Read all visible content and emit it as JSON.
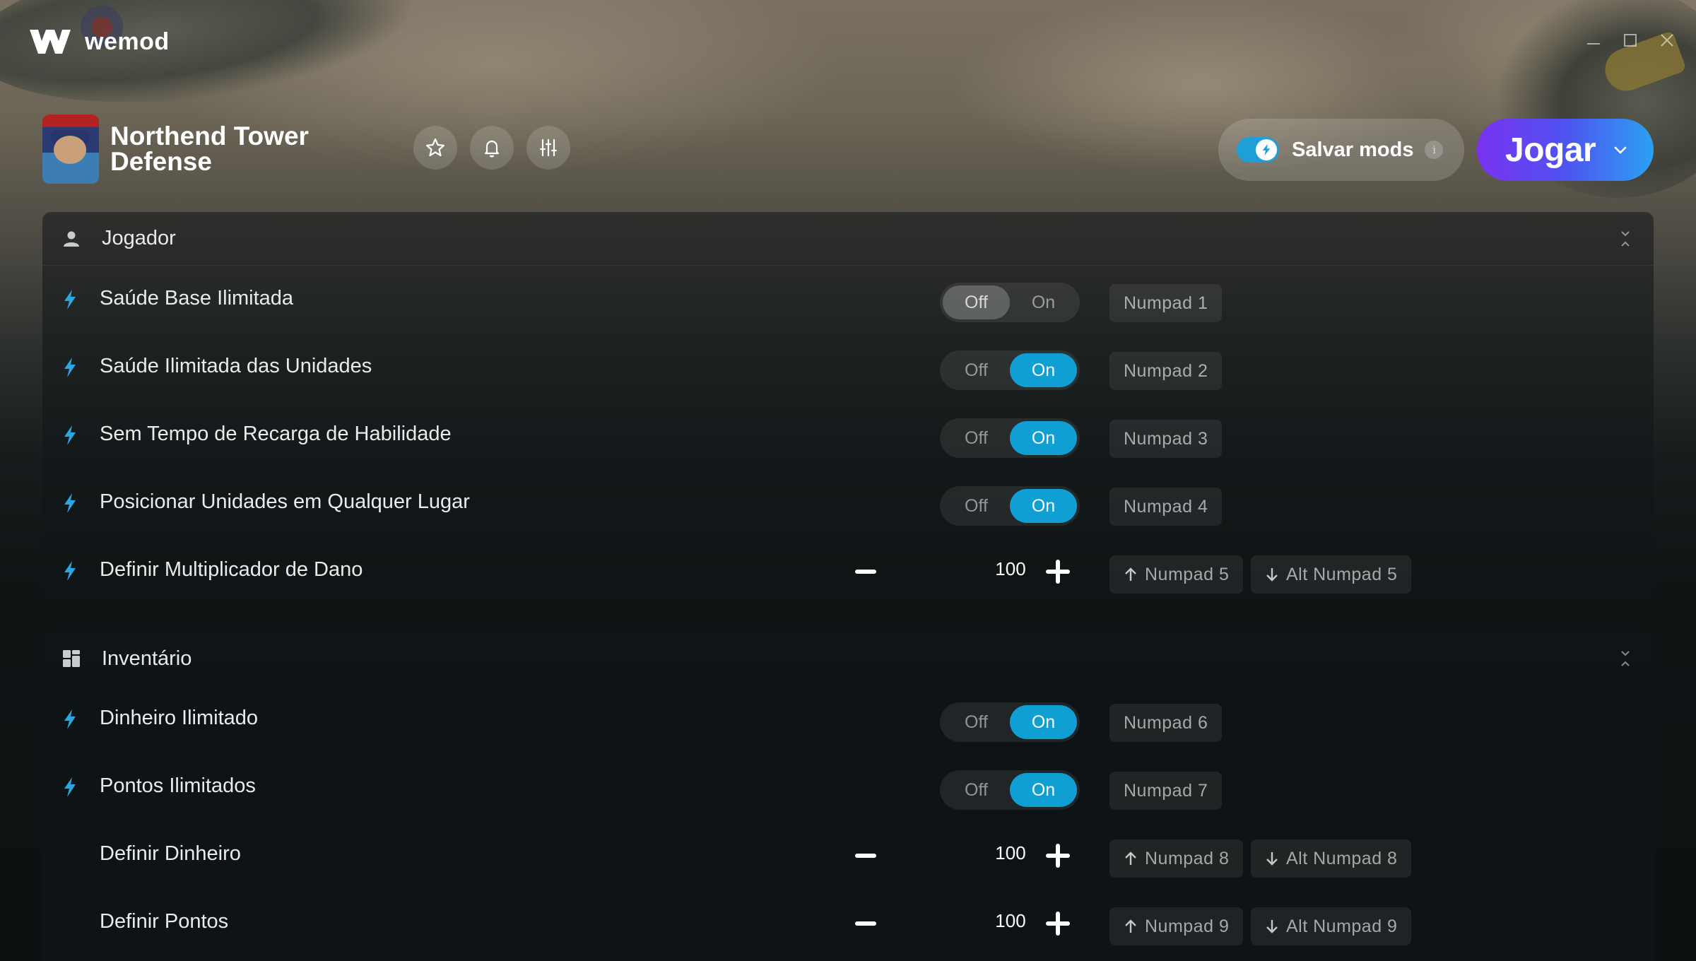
{
  "app": {
    "name": "wemod"
  },
  "game": {
    "title": "Northend Tower Defense"
  },
  "header": {
    "save_mods_label": "Salvar mods",
    "save_mods_enabled": true,
    "info_glyph": "i",
    "play_label": "Jogar",
    "icons": [
      "star-icon",
      "bell-icon",
      "sliders-icon"
    ]
  },
  "sections": [
    {
      "title": "Jogador",
      "icon": "user-icon",
      "rows": [
        {
          "name": "Saúde Base Ilimitada",
          "type": "toggle",
          "state": "Off",
          "off": "Off",
          "on": "On",
          "key": "Numpad 1"
        },
        {
          "name": "Saúde Ilimitada das Unidades",
          "type": "toggle",
          "state": "On",
          "off": "Off",
          "on": "On",
          "key": "Numpad 2"
        },
        {
          "name": "Sem Tempo de Recarga de Habilidade",
          "type": "toggle",
          "state": "On",
          "off": "Off",
          "on": "On",
          "key": "Numpad 3"
        },
        {
          "name": "Posicionar Unidades em Qualquer Lugar",
          "type": "toggle",
          "state": "On",
          "off": "Off",
          "on": "On",
          "key": "Numpad 4"
        },
        {
          "name": "Definir Multiplicador de Dano",
          "type": "stepper",
          "value": "100",
          "key_up": "Numpad 5",
          "key_down": "Alt Numpad 5"
        }
      ]
    },
    {
      "title": "Inventário",
      "icon": "grid-icon",
      "rows": [
        {
          "name": "Dinheiro Ilimitado",
          "type": "toggle",
          "state": "On",
          "off": "Off",
          "on": "On",
          "key": "Numpad 6"
        },
        {
          "name": "Pontos Ilimitados",
          "type": "toggle",
          "state": "On",
          "off": "Off",
          "on": "On",
          "key": "Numpad 7"
        },
        {
          "name": "Definir Dinheiro",
          "type": "stepper",
          "value": "100",
          "key_up": "Numpad 8",
          "key_down": "Alt Numpad 8"
        },
        {
          "name": "Definir Pontos",
          "type": "stepper",
          "value": "100",
          "key_up": "Numpad 9",
          "key_down": "Alt Numpad 9"
        }
      ]
    }
  ],
  "colors": {
    "accent": "#109fd2",
    "play_start": "#7a32f0",
    "play_end": "#2aa2f2"
  }
}
